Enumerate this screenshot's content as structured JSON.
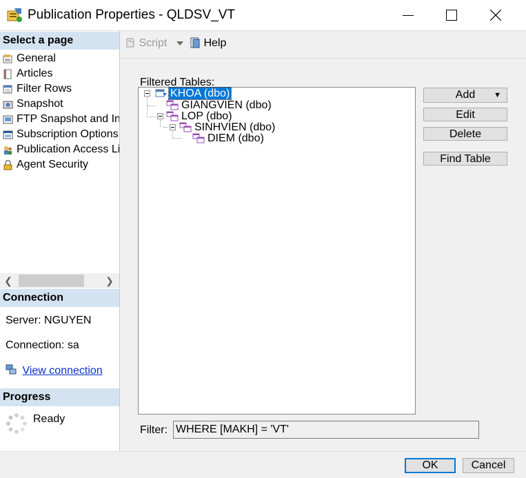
{
  "window": {
    "title": "Publication Properties - QLDSV_VT",
    "icon": "publication-icon"
  },
  "left_pane": {
    "select_page_header": "Select a page",
    "pages": [
      {
        "label": "General",
        "icon": "general-icon"
      },
      {
        "label": "Articles",
        "icon": "articles-icon"
      },
      {
        "label": "Filter Rows",
        "icon": "filter-rows-icon",
        "selected": true
      },
      {
        "label": "Snapshot",
        "icon": "snapshot-icon"
      },
      {
        "label": "FTP Snapshot and In",
        "icon": "ftp-snapshot-icon"
      },
      {
        "label": "Subscription Options",
        "icon": "subscription-options-icon"
      },
      {
        "label": "Publication Access Li",
        "icon": "publication-access-icon"
      },
      {
        "label": "Agent Security",
        "icon": "agent-security-icon"
      }
    ],
    "connection_header": "Connection",
    "server": "Server: NGUYEN",
    "connection": "Connection: sa",
    "view_connection": "View connection",
    "progress_header": "Progress",
    "progress_status": "Ready"
  },
  "toolbar": {
    "script_label": "Script",
    "help_label": "Help"
  },
  "main": {
    "filtered_tables_label": "Filtered Tables:",
    "tree": [
      {
        "label": "KHOA (dbo)",
        "level": 0,
        "selected": true
      },
      {
        "label": "GIANGVIEN (dbo)",
        "level": 1
      },
      {
        "label": "LOP (dbo)",
        "level": 1
      },
      {
        "label": "SINHVIEN (dbo)",
        "level": 2
      },
      {
        "label": "DIEM (dbo)",
        "level": 3
      }
    ],
    "buttons": {
      "add": "Add",
      "edit": "Edit",
      "delete": "Delete",
      "find_table": "Find Table"
    },
    "filter_label": "Filter:",
    "filter_value": "WHERE [MAKH] = 'VT'"
  },
  "footer": {
    "ok": "OK",
    "cancel": "Cancel"
  },
  "colors": {
    "header_bg": "#d3e3f1",
    "selection": "#0078d7",
    "link": "#0a2fd1"
  }
}
